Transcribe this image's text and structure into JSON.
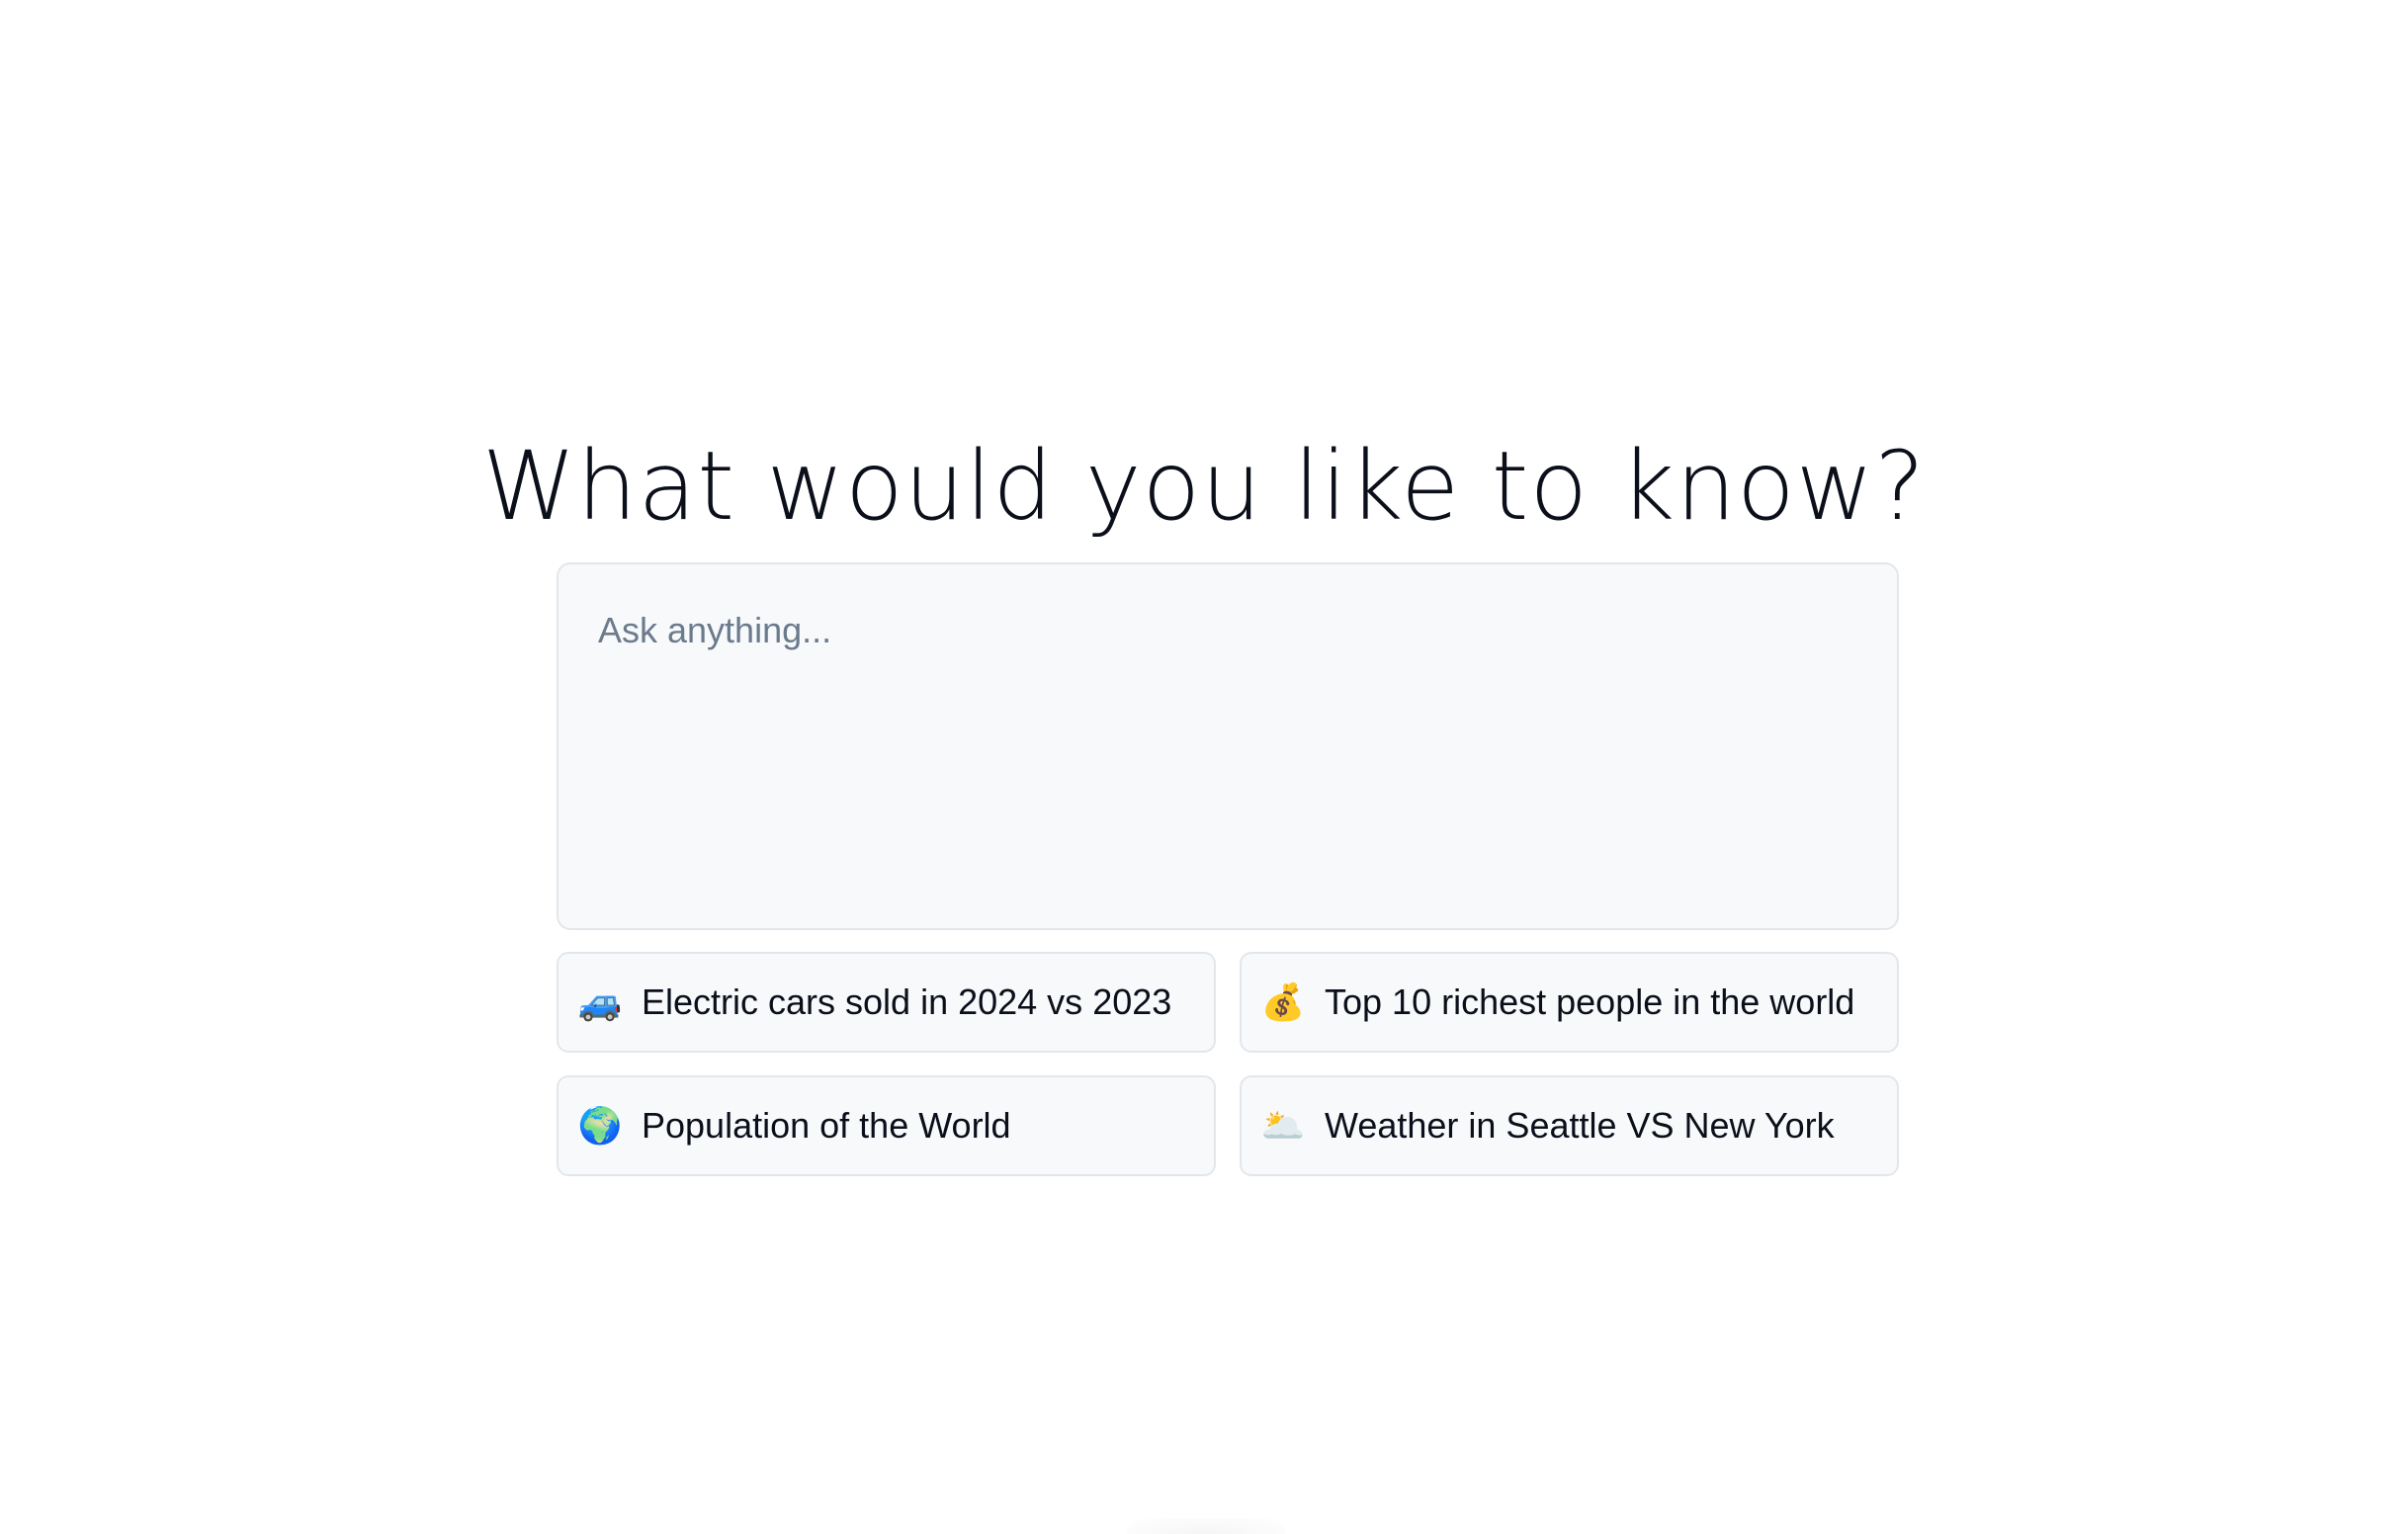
{
  "hero": {
    "title": "What would you like to know?"
  },
  "ask": {
    "placeholder": "Ask anything...",
    "value": ""
  },
  "suggestions": [
    {
      "icon": "car-icon",
      "emoji": "🚙",
      "label": "Electric cars sold in 2024 vs 2023"
    },
    {
      "icon": "money-bag-icon",
      "emoji": "💰",
      "label": "Top 10 richest people in the world"
    },
    {
      "icon": "globe-icon",
      "emoji": "🌍",
      "label": "Population of the World"
    },
    {
      "icon": "sun-behind-cloud-icon",
      "emoji": "🌥️",
      "label": "Weather in Seattle VS New York"
    }
  ],
  "colors": {
    "background": "#ffffff",
    "surface": "#f7f9fb",
    "border": "#e3e7ec",
    "text": "#0b0f1a",
    "placeholder": "#6b7a8c"
  }
}
